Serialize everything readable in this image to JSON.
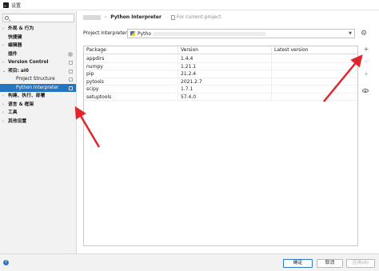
{
  "window": {
    "title": "设置"
  },
  "sidebar": {
    "search_placeholder": "",
    "items": [
      {
        "label": "外观 & 行为",
        "arrow": "›",
        "bold": true,
        "child": false,
        "selected": false,
        "badge": ""
      },
      {
        "label": "快捷键",
        "arrow": "",
        "bold": true,
        "child": false,
        "selected": false,
        "badge": ""
      },
      {
        "label": "编辑器",
        "arrow": "›",
        "bold": true,
        "child": false,
        "selected": false,
        "badge": ""
      },
      {
        "label": "插件",
        "arrow": "",
        "bold": true,
        "child": false,
        "selected": false,
        "badge": "round"
      },
      {
        "label": "Version Control",
        "arrow": "›",
        "bold": true,
        "child": false,
        "selected": false,
        "badge": "square"
      },
      {
        "label": "项目: ai0",
        "arrow": "⌄",
        "bold": true,
        "child": false,
        "selected": false,
        "badge": "square"
      },
      {
        "label": "Project Structure",
        "arrow": "",
        "bold": false,
        "child": true,
        "selected": false,
        "badge": "square"
      },
      {
        "label": "Python Interpreter",
        "arrow": "",
        "bold": false,
        "child": true,
        "selected": true,
        "badge": "square"
      },
      {
        "label": "构建、执行、部署",
        "arrow": "›",
        "bold": true,
        "child": false,
        "selected": false,
        "badge": ""
      },
      {
        "label": "语言 & 框架",
        "arrow": "›",
        "bold": true,
        "child": false,
        "selected": false,
        "badge": ""
      },
      {
        "label": "工具",
        "arrow": "›",
        "bold": true,
        "child": false,
        "selected": false,
        "badge": ""
      },
      {
        "label": "其他设置",
        "arrow": "›",
        "bold": true,
        "child": false,
        "selected": false,
        "badge": ""
      }
    ]
  },
  "breadcrumb": {
    "separator": "›",
    "current": "Python Interpreter",
    "project_hint": "For current project"
  },
  "interpreter": {
    "label": "Project Interpreter:",
    "value": "Pytho"
  },
  "packages": {
    "columns": [
      "Package",
      "Version",
      "Latest version"
    ],
    "rows": [
      {
        "package": "appdirs",
        "version": "1.4.4",
        "latest": ""
      },
      {
        "package": "numpy",
        "version": "1.21.1",
        "latest": ""
      },
      {
        "package": "pip",
        "version": "21.2.4",
        "latest": ""
      },
      {
        "package": "pytools",
        "version": "2021.2.7",
        "latest": ""
      },
      {
        "package": "scipy",
        "version": "1.7.1",
        "latest": ""
      },
      {
        "package": "setuptools",
        "version": "57.4.0",
        "latest": ""
      }
    ]
  },
  "toolbar": {
    "add": "+",
    "remove": "−",
    "upgrade": "▲"
  },
  "footer": {
    "ok": "确定",
    "cancel": "取消",
    "apply": "应用(A)",
    "help": "?"
  },
  "colors": {
    "selection": "#2675bf",
    "annotation_arrow": "#e0262b"
  }
}
